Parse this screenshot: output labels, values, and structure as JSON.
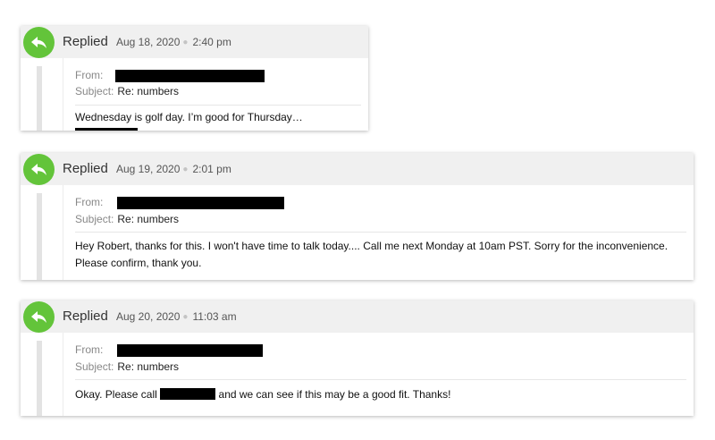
{
  "emails": [
    {
      "status": "Replied",
      "date": "Aug 18, 2020",
      "time": "2:40 pm",
      "from_label": "From:",
      "subject_label": "Subject:",
      "subject": "Re: numbers",
      "message_before": "Wednesday is golf day. I’m good for Thursday…",
      "message_after": ""
    },
    {
      "status": "Replied",
      "date": "Aug 19, 2020",
      "time": "2:01 pm",
      "from_label": "From:",
      "subject_label": "Subject:",
      "subject": "Re: numbers",
      "message": "Hey Robert, thanks for this. I won't have time to talk today.... Call me next Monday at 10am PST. Sorry for the inconvenience. Please confirm, thank you."
    },
    {
      "status": "Replied",
      "date": "Aug 20, 2020",
      "time": "11:03 am",
      "from_label": "From:",
      "subject_label": "Subject:",
      "subject": "Re: numbers",
      "message_before": "Okay. Please call",
      "message_after": "and we can see if this may be a good fit. Thanks!"
    }
  ],
  "colors": {
    "reply_icon": "#63c43a",
    "header_bg": "#f0f0f0",
    "redaction": "#000000"
  },
  "icons": {
    "reply": "reply-arrow-icon"
  }
}
